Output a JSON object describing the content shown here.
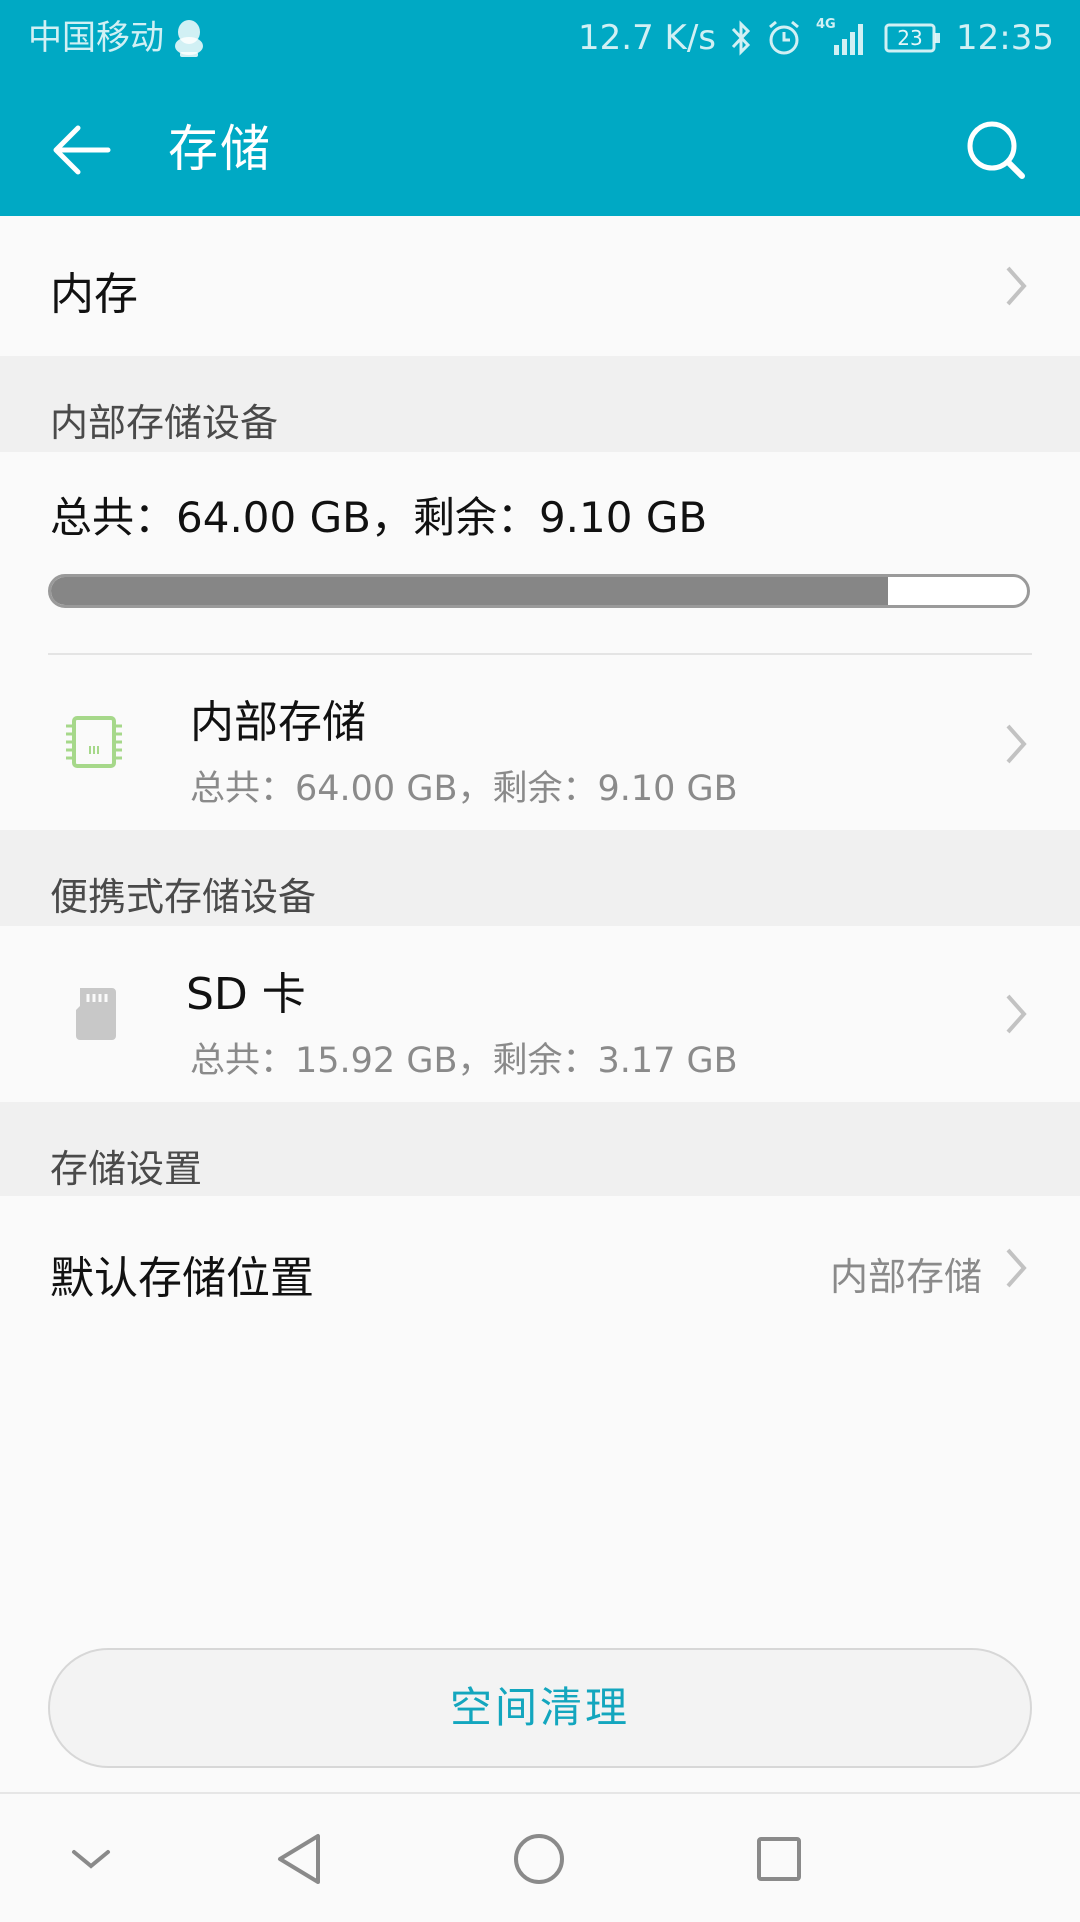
{
  "status_bar": {
    "carrier": "中国移动",
    "network_speed": "12.7 K/s",
    "network_type": "4G",
    "battery": "23",
    "time": "12:35",
    "icons": [
      "qq-icon",
      "bluetooth-icon",
      "alarm-icon",
      "signal-icon",
      "battery-icon"
    ]
  },
  "header": {
    "title": "存储"
  },
  "memory_row": {
    "label": "内存"
  },
  "internal_section": {
    "heading": "内部存储设备",
    "summary": "总共：64.00 GB，剩余：9.10 GB",
    "used_fraction": 0.858,
    "item": {
      "title": "内部存储",
      "subtitle": "总共：64.00 GB，剩余：9.10 GB",
      "icon": "chip-icon"
    }
  },
  "portable_section": {
    "heading": "便携式存储设备",
    "item": {
      "title": "SD 卡",
      "subtitle": "总共：15.92 GB，剩余：3.17 GB",
      "icon": "sd-card-icon"
    }
  },
  "settings_section": {
    "heading": "存储设置",
    "default_location": {
      "label": "默认存储位置",
      "value": "内部存储"
    }
  },
  "clean_button": {
    "label": "空间清理"
  },
  "colors": {
    "accent": "#00a9c4",
    "button_text": "#13a6be",
    "chip_icon": "#a6d88a"
  },
  "nav_bar": {
    "icons": [
      "collapse-icon",
      "back-triangle-icon",
      "home-circle-icon",
      "recents-square-icon"
    ]
  }
}
